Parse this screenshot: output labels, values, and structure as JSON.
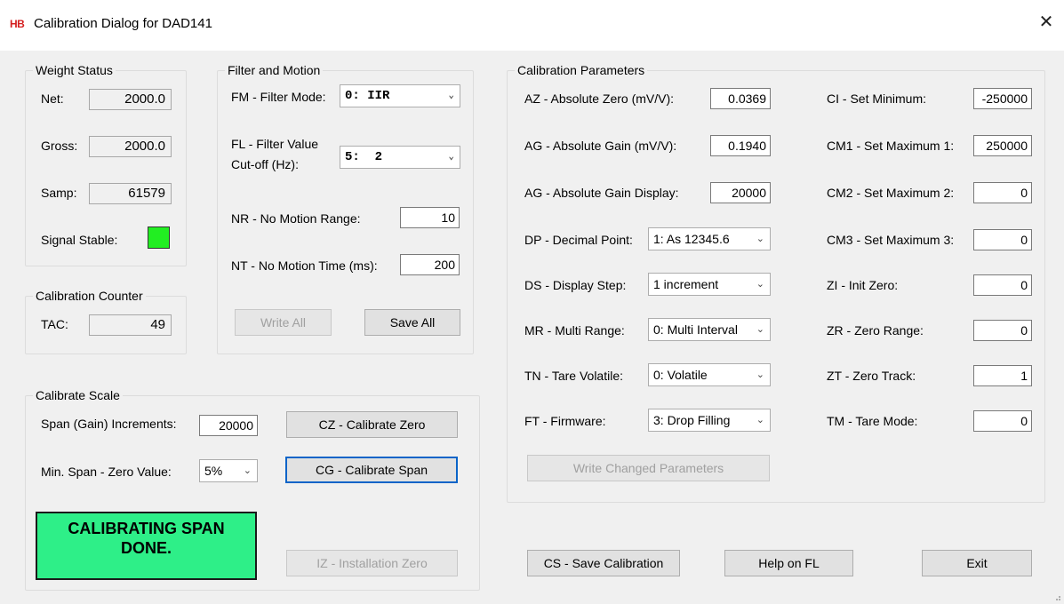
{
  "window": {
    "app_icon_text": "HB",
    "title": "Calibration Dialog for DAD141",
    "close_glyph": "✕"
  },
  "weight_status": {
    "title": "Weight Status",
    "net_label": "Net:",
    "net_value": "2000.0",
    "gross_label": "Gross:",
    "gross_value": "2000.0",
    "samp_label": "Samp:",
    "samp_value": "61579",
    "stable_label": "Signal Stable:",
    "stable_color": "#22ee22"
  },
  "calibration_counter": {
    "title": "Calibration Counter",
    "tac_label": "TAC:",
    "tac_value": "49"
  },
  "filter_motion": {
    "title": "Filter and Motion",
    "fm_label": "FM - Filter Mode:",
    "fm_value": "0: IIR",
    "fl_label_line1": "FL - Filter Value",
    "fl_label_line2": "Cut-off (Hz):",
    "fl_value": "5:  2",
    "nr_label": "NR - No Motion Range:",
    "nr_value": "10",
    "nt_label": "NT - No Motion Time (ms):",
    "nt_value": "200",
    "write_all": "Write All",
    "save_all": "Save All"
  },
  "calibration_parameters": {
    "title": "Calibration Parameters",
    "az_label": "AZ - Absolute Zero (mV/V):",
    "az_value": "0.0369",
    "ag_label": "AG - Absolute Gain (mV/V):",
    "ag_value": "0.1940",
    "agd_label": "AG - Absolute Gain Display:",
    "agd_value": "20000",
    "dp_label": "DP - Decimal Point:",
    "dp_value": "1: As 12345.6",
    "ds_label": "DS - Display Step:",
    "ds_value": "1 increment",
    "mr_label": "MR - Multi Range:",
    "mr_value": "0: Multi Interval",
    "tn_label": "TN - Tare Volatile:",
    "tn_value": "0: Volatile",
    "ft_label": "FT - Firmware:",
    "ft_value": "3: Drop Filling",
    "ci_label": "CI - Set Minimum:",
    "ci_value": "-250000",
    "cm1_label": "CM1 - Set Maximum 1:",
    "cm1_value": "250000",
    "cm2_label": "CM2 - Set Maximum 2:",
    "cm2_value": "0",
    "cm3_label": "CM3 - Set Maximum 3:",
    "cm3_value": "0",
    "zi_label": "ZI - Init Zero:",
    "zi_value": "0",
    "zr_label": "ZR - Zero Range:",
    "zr_value": "0",
    "zt_label": "ZT - Zero Track:",
    "zt_value": "1",
    "tm_label": "TM - Tare Mode:",
    "tm_value": "0",
    "write_changed": "Write Changed Parameters"
  },
  "calibrate_scale": {
    "title": "Calibrate Scale",
    "span_label": "Span (Gain) Increments:",
    "span_value": "20000",
    "minspan_label": "Min. Span - Zero Value:",
    "minspan_value": "5%",
    "cz_button": "CZ - Calibrate Zero",
    "cg_button": "CG - Calibrate Span",
    "iz_button": "IZ - Installation Zero",
    "status_line1": "CALIBRATING SPAN",
    "status_line2": "DONE.",
    "status_color": "#2eef88"
  },
  "footer": {
    "cs_button": "CS - Save Calibration",
    "help_button": "Help on FL",
    "exit_button": "Exit"
  },
  "icons": {
    "dropdown": "chevron-down-icon",
    "close": "close-icon"
  }
}
